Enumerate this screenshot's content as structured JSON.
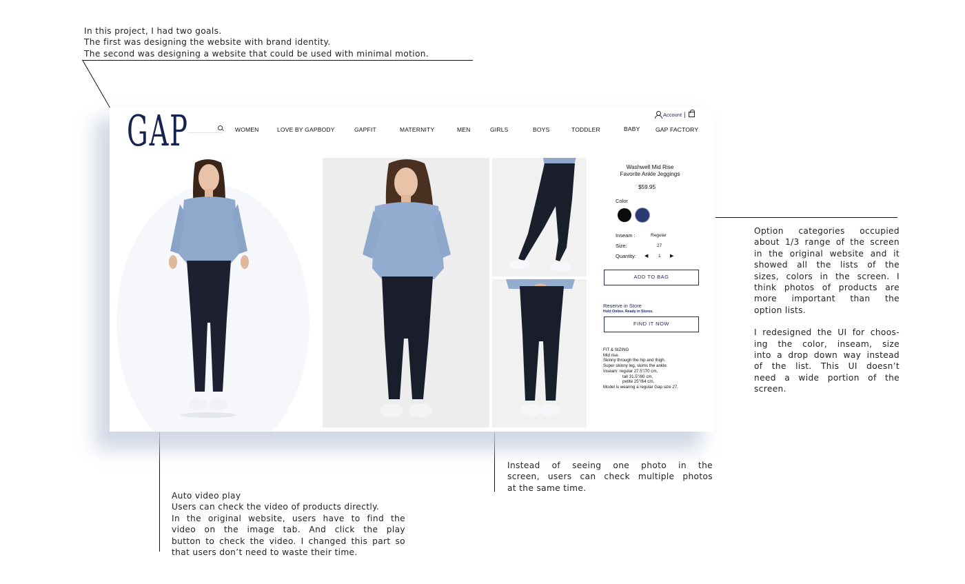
{
  "annotations": {
    "intro": [
      "In this project, I had two goals.",
      "The first was designing the website with brand identity.",
      "The second was designing a website that could be used with minimal motion."
    ],
    "options_p1": [
      "Option categories occupied",
      "about 1/3 range of the screen",
      "in the original website and it",
      "showed all the lists of the",
      "sizes, colors in the screen. I",
      "think photos of products are",
      "more important than the",
      "option lists."
    ],
    "options_p2": [
      "I redesigned the UI for choos-",
      "ing the color, inseam, size",
      "into a drop down way instead",
      "of the list. This UI doesn’t",
      "need a wide portion of the",
      "screen."
    ],
    "video": [
      "Auto video play",
      "Users can check the video of products directly.",
      "In the original website, users have to find the",
      "video on the image tab. And click the play",
      "button to check the video. I changed this part so",
      "that users don’t need to waste their time."
    ],
    "photos": [
      "Instead of seeing one photo in the",
      "screen, users can check multiple photos",
      "at the same time."
    ]
  },
  "site": {
    "logo": "GAP",
    "account_label": "Account",
    "separator": "|",
    "nav": [
      "WOMEN",
      "LOVE BY GAPBODY",
      "GAPFIT",
      "MATERNITY",
      "MEN",
      "GIRLS",
      "BOYS",
      "TODDLER",
      "BABY",
      "GAP FACTORY"
    ],
    "product": {
      "title_line1": "Washwell Mid Rise",
      "title_line2": "Favorite Ankle Jeggings",
      "price": "$59.95",
      "color_label": "Color",
      "swatch_colors": [
        "#0b0b0b",
        "#2a3a70"
      ],
      "inseam_label": "Inseam :",
      "inseam_value": "Regular",
      "size_label": "Size:",
      "size_value": "27",
      "quantity_label": "Quantity:",
      "quantity_value": "1",
      "add_to_bag": "ADD TO BAG",
      "reserve_title": "Reserve in Store",
      "reserve_sub": "Hold Online. Ready in Stores.",
      "find_it_now": "FIND IT NOW",
      "fit_heading": "FIT & SIZING",
      "fit_lines": [
        "Mid rise.",
        "Skinny through the hip and thigh.",
        "Super skinny leg, skims the ankle.",
        "Inseam: regular 27.5\"/70 cm,",
        "tall 31.5\"/80 cm,",
        "petite 25\"/64 cm.",
        "Model is wearing a regular Gap size 27."
      ]
    }
  }
}
